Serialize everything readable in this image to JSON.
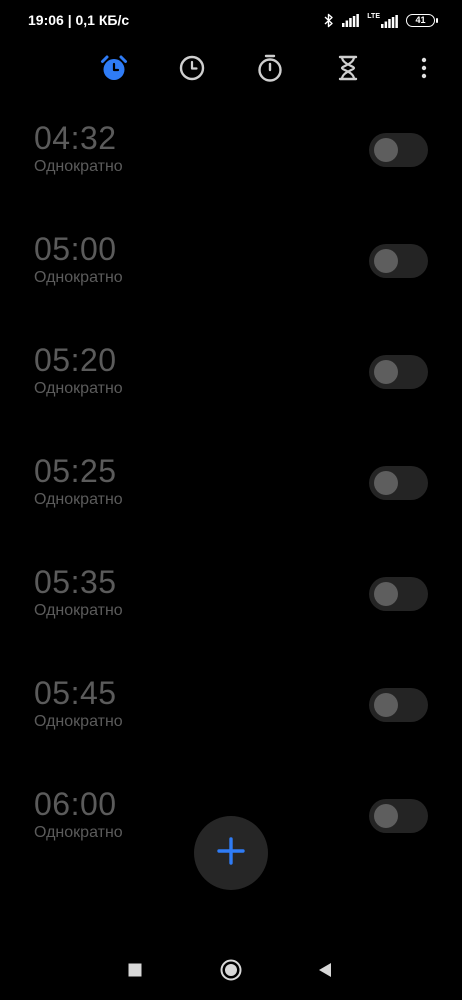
{
  "status_bar": {
    "time": "19:06 | 0,1 КБ/с",
    "network_type": "LTE",
    "battery": "41",
    "icons": [
      "bluetooth-icon",
      "signal-icon",
      "lte-signal-icon",
      "battery-icon"
    ]
  },
  "tabs": [
    {
      "icon": "alarm-clock-icon",
      "active": true
    },
    {
      "icon": "clock-icon",
      "active": false
    },
    {
      "icon": "stopwatch-icon",
      "active": false
    },
    {
      "icon": "hourglass-icon",
      "active": false
    }
  ],
  "menu_icon": "more-vertical-icon",
  "colors": {
    "accent": "#2f7cf6",
    "inactive_text": "#5b5b5b",
    "icon": "#cfcfcf",
    "background": "#000000"
  },
  "alarms": [
    {
      "time": "04:32",
      "repeat": "Однократно",
      "enabled": false
    },
    {
      "time": "05:00",
      "repeat": "Однократно",
      "enabled": false
    },
    {
      "time": "05:20",
      "repeat": "Однократно",
      "enabled": false
    },
    {
      "time": "05:25",
      "repeat": "Однократно",
      "enabled": false
    },
    {
      "time": "05:35",
      "repeat": "Однократно",
      "enabled": false
    },
    {
      "time": "05:45",
      "repeat": "Однократно",
      "enabled": false
    },
    {
      "time": "06:00",
      "repeat": "Однократно",
      "enabled": false
    }
  ],
  "fab_icon": "plus-icon",
  "nav_bar": {
    "icons": [
      "recents-icon",
      "home-icon",
      "back-icon"
    ]
  }
}
